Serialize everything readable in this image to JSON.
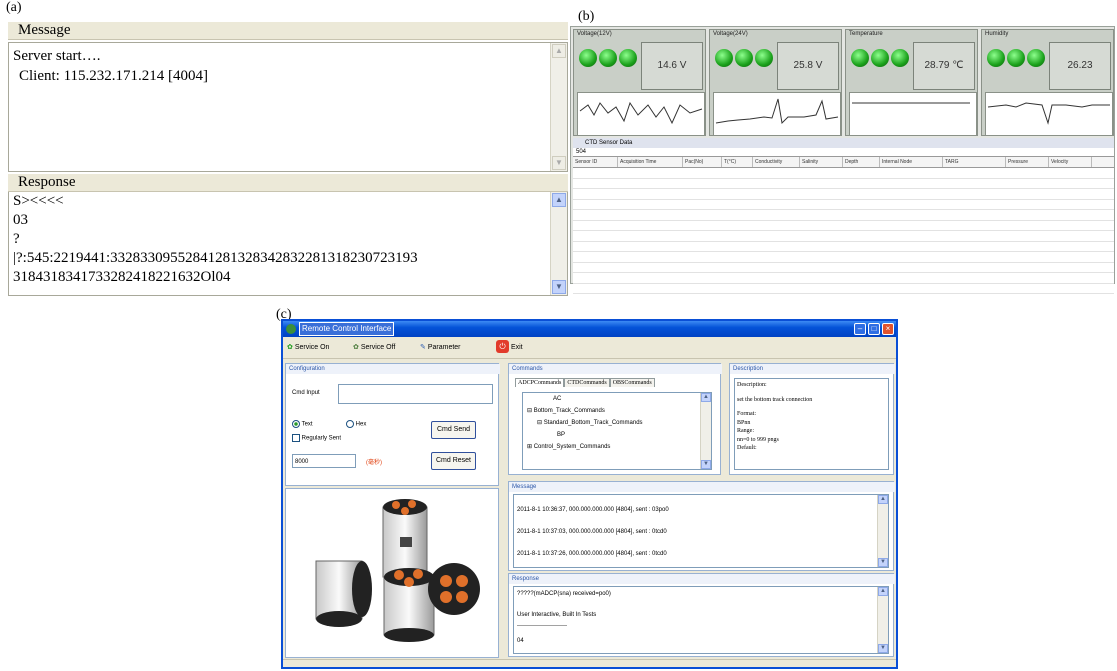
{
  "labels": {
    "a": "(a)",
    "b": "(b)",
    "c": "(c)"
  },
  "panel_a": {
    "message_header": "Message",
    "message_lines": [
      "Server start….",
      "Client:  115.232.171.214 [4004]"
    ],
    "response_header": "Response",
    "response_lines": [
      "S><<<<",
      "03",
      "?",
      "|?:545:2219441:3328330955284128132834283228131823072319​3",
      "3184318341733282418221632Ol04"
    ]
  },
  "panel_b": {
    "gauges": [
      {
        "title": "Voltage(12V)",
        "value": "14.6 V"
      },
      {
        "title": "Voltage(24V)",
        "value": "25.8 V"
      },
      {
        "title": "Temperature",
        "value": "28.79 ℃"
      },
      {
        "title": "Humidity",
        "value": "26.23"
      }
    ],
    "table_tab": "CTD Sensor Data",
    "table_id": "504",
    "columns": [
      "Sensor ID",
      "Acquisition Time",
      "Pac(No)",
      "T(°C)",
      "Conductivity",
      "Salinity",
      "Depth",
      "Internal Node",
      "TARG",
      "Pressure",
      "Velocity"
    ]
  },
  "panel_c": {
    "window_title": "Remote Control Interface",
    "toolbar": {
      "service_on": "Service On",
      "service_off": "Service Off",
      "parameter": "Parameter",
      "exit": "Exit"
    },
    "config": {
      "title": "Configuration",
      "cmd_input_label": "Cmd Input",
      "radio_text": "Text",
      "radio_hex": "Hex",
      "regularly_sent": "Regularly Sent",
      "interval_value": "8000",
      "interval_unit": "(毫秒)",
      "cmd_send": "Cmd Send",
      "cmd_reset": "Cmd Reset"
    },
    "commands": {
      "title": "Commands",
      "tabs": [
        "ADCPCommands",
        "CTDCommands",
        "OBSCommands"
      ],
      "tree": [
        "AC",
        "Bottom_Track_Commands",
        "Standard_Bottom_Track_Commands",
        "BP",
        "Control_System_Commands"
      ]
    },
    "description": {
      "title": "Description",
      "lines": [
        "Description:",
        "set the bottom track connection",
        "Format:",
        "BPnn",
        "Range:",
        "nn=0 to 999 pngs",
        "Default:"
      ]
    },
    "message": {
      "title": "Message",
      "lines": [
        "2011-8-1 10:36:37, 000.000.000.000 [4804], sent : 03po0",
        "2011-8-1 10:37:03, 000.000.000.000 [4804], sent : 0tcd0",
        "2011-8-1 10:37:26, 000.000.000.000 [4804], sent : 0tcd0"
      ]
    },
    "response": {
      "title": "Response",
      "lines": [
        "?????(mADCP(sna) received=po0)",
        "User Interactive, Built In Tests",
        "-------------------------",
        "04"
      ]
    }
  }
}
